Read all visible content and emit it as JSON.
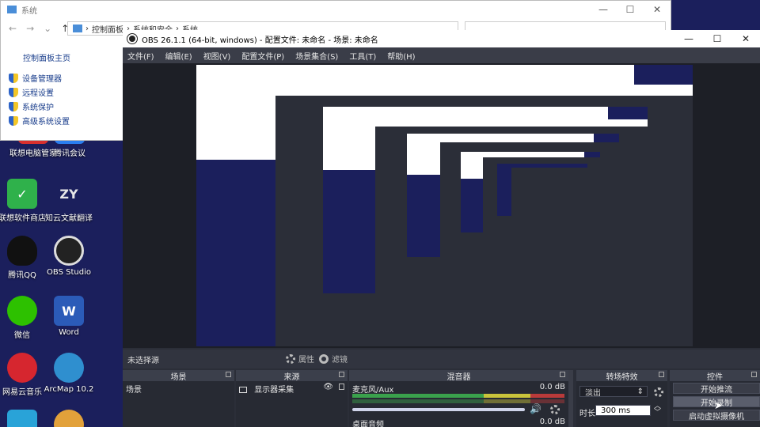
{
  "colors": {
    "desktop_bg": "#1b1f5c",
    "obs_dark": "#2b2e38",
    "obs_panel": "#272a33",
    "accent_link": "#1a3e8c"
  },
  "desktop_icons": [
    {
      "label": "联想电脑管家",
      "color": "#d8302e",
      "glyph": ""
    },
    {
      "label": "腾讯会议",
      "color": "#2a7ef0",
      "glyph": ""
    },
    {
      "label": "联想软件商店",
      "color": "#2fb14b",
      "glyph": ""
    },
    {
      "label": "知云文献翻译",
      "color": "#b71c1c",
      "glyph": "ZY"
    },
    {
      "label": "腾讯QQ",
      "color": "#111111",
      "glyph": ""
    },
    {
      "label": "OBS Studio",
      "color": "#222222",
      "glyph": ""
    },
    {
      "label": "微信",
      "color": "#2dc100",
      "glyph": ""
    },
    {
      "label": "Word",
      "color": "#2b5bb8",
      "glyph": "W"
    },
    {
      "label": "网易云音乐",
      "color": "#d6262f",
      "glyph": ""
    },
    {
      "label": "ArcMap 10.2",
      "color": "#2f8fcf",
      "glyph": ""
    }
  ],
  "control_panel": {
    "title": "系统",
    "address": [
      "控制面板",
      "系统和安全",
      "系统"
    ],
    "home_link": "控制面板主页",
    "links": [
      "设备管理器",
      "远程设置",
      "系统保护",
      "高级系统设置"
    ],
    "window_controls": [
      "—",
      "☐",
      "✕"
    ]
  },
  "obs": {
    "title": "OBS 26.1.1 (64-bit, windows) - 配置文件: 未命名 - 场景: 未命名",
    "window_controls": [
      "—",
      "☐",
      "✕"
    ],
    "menu": [
      "文件(F)",
      "编辑(E)",
      "视图(V)",
      "配置文件(P)",
      "场景集合(S)",
      "工具(T)",
      "帮助(H)"
    ],
    "no_source": "未选择源",
    "properties": "属性",
    "filters": "滤镜",
    "docks": {
      "scenes": {
        "title": "场景",
        "items": [
          "场景"
        ]
      },
      "sources": {
        "title": "来源",
        "items": [
          "显示器采集"
        ]
      },
      "mixer": {
        "title": "混音器",
        "channels": [
          {
            "name": "麦克风/Aux",
            "db": "0.0 dB"
          },
          {
            "name": "桌面音频",
            "db": "0.0 dB"
          }
        ]
      },
      "transitions": {
        "title": "转场特效",
        "type": "淡出",
        "duration_label": "时长",
        "duration": "300 ms"
      },
      "controls": {
        "title": "控件",
        "buttons": [
          "开始推流",
          "开始录制",
          "启动虚拟摄像机"
        ]
      }
    }
  }
}
